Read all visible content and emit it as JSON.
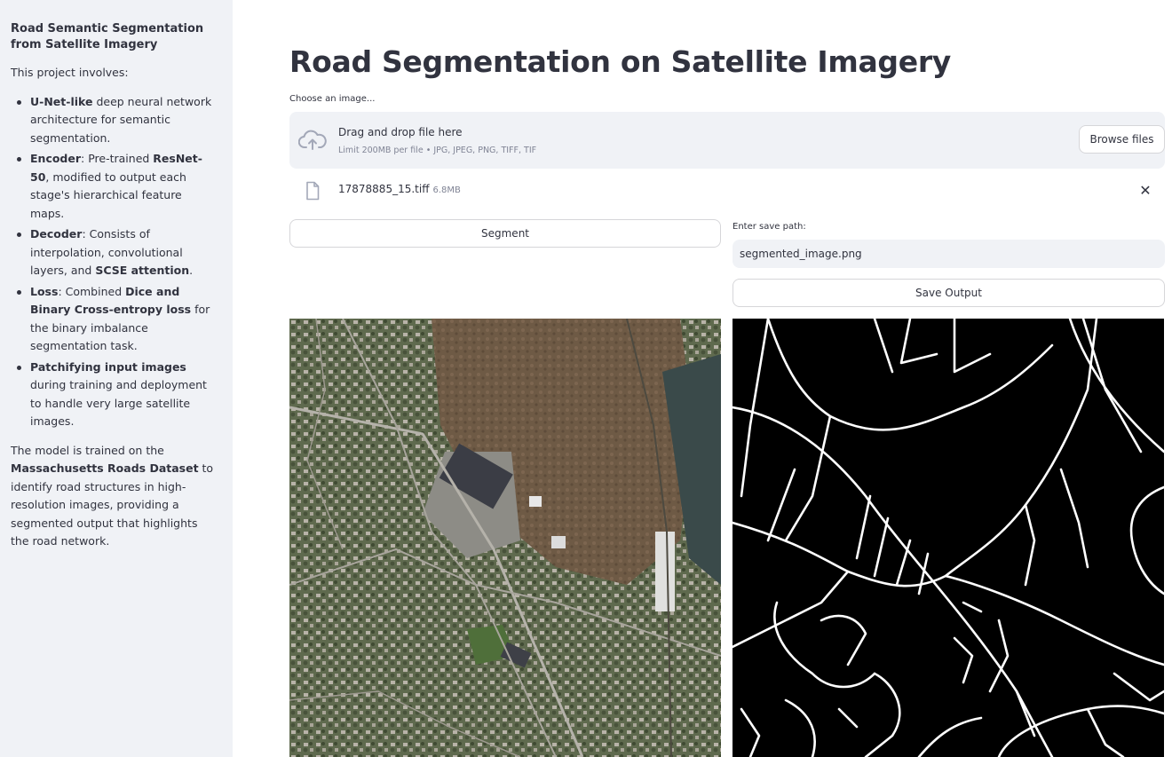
{
  "sidebar": {
    "title": "Road Semantic Segmentation from Satellite Imagery",
    "intro": "This project involves:",
    "items": [
      {
        "b1": "U-Net-like",
        "t1": " deep neural network architecture for semantic segmentation."
      },
      {
        "b1": "Encoder",
        "t1": ": Pre-trained ",
        "b2": "ResNet-50",
        "t2": ", modified to output each stage's hierarchical feature maps."
      },
      {
        "b1": "Decoder",
        "t1": ": Consists of interpolation, convolutional layers, and ",
        "b2": "SCSE attention",
        "t2": "."
      },
      {
        "b1": "Loss",
        "t1": ": Combined ",
        "b2": "Dice and Binary Cross-entropy loss",
        "t2": " for the binary imbalance segmentation task."
      },
      {
        "b1": "Patchifying input images",
        "t1": " during training and deployment to handle very large satellite images."
      }
    ],
    "footer": {
      "t1": "The model is trained on the ",
      "b1": "Massachusetts Roads Dataset",
      "t2": " to identify road structures in high-resolution images, providing a segmented output that highlights the road network."
    }
  },
  "main": {
    "title": "Road Segmentation on Satellite Imagery",
    "uploader": {
      "label": "Choose an image...",
      "drop_text": "Drag and drop file here",
      "limit_text": "Limit 200MB per file • JPG, JPEG, PNG, TIFF, TIF",
      "browse_label": "Browse files",
      "file_name": "17878885_15.tiff",
      "file_size": "6.8MB",
      "close_glyph": "✕"
    },
    "segment_label": "Segment",
    "save_path_label": "Enter save path:",
    "save_path_value": "segmented_image.png",
    "save_button_label": "Save Output"
  },
  "icons": {
    "upload": "cloud-upload-icon",
    "file": "file-icon",
    "close": "close-icon"
  },
  "colors": {
    "sidebar_bg": "#f0f2f6",
    "text": "#31333f",
    "muted": "#808495",
    "border": "#d6d6d9"
  }
}
